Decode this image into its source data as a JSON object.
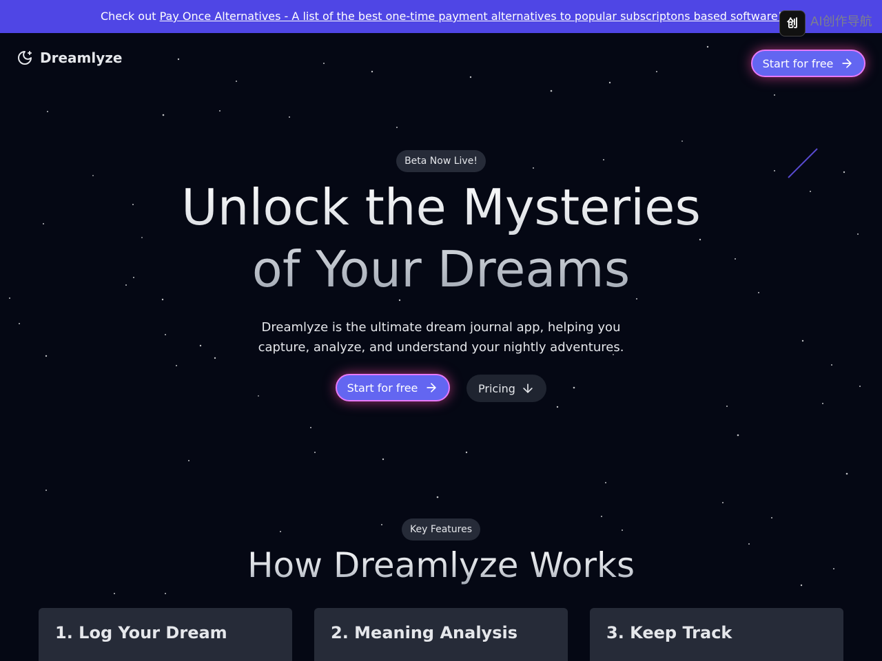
{
  "banner": {
    "prefix": "Check out ",
    "link_text": "Pay Once Alternatives - A list of the best one-time payment alternatives to popular subscriptons based software!"
  },
  "watermark": {
    "logo_glyph": "创",
    "text": "AI创作导航"
  },
  "nav": {
    "brand": "Dreamlyze",
    "brand_icon": "moon-star-icon",
    "cta_label": "Start for free",
    "cta_icon": "arrow-right-icon"
  },
  "hero": {
    "badge": "Beta Now Live!",
    "title_line1": "Unlock the Mysteries",
    "title_line2": "of Your Dreams",
    "subtitle": "Dreamlyze is the ultimate dream journal app, helping you capture, analyze, and understand your nightly adventures.",
    "primary_cta": "Start for free",
    "secondary_cta": "Pricing",
    "secondary_icon": "arrow-down-icon"
  },
  "features": {
    "badge": "Key Features",
    "title": "How Dreamlyze Works",
    "cards": [
      {
        "title": "1. Log Your Dream"
      },
      {
        "title": "2. Meaning Analysis"
      },
      {
        "title": "3. Keep Track"
      }
    ]
  },
  "colors": {
    "background": "#050814",
    "banner": "#4f46e5",
    "accent": "#6366f1",
    "glow": "#ec4899",
    "card": "#262b38"
  }
}
